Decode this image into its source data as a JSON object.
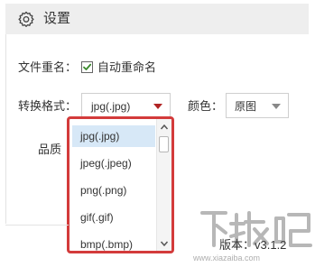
{
  "header": {
    "title": "设置",
    "icon": "gear-icon"
  },
  "rename": {
    "label": "文件重名：",
    "checkbox_label": "自动重命名",
    "checked": true
  },
  "format": {
    "label": "转换格式：",
    "selected": "jpg(.jpg)",
    "caret_color": "#b02323",
    "options": [
      "jpg(.jpg)",
      "jpeg(.jpeg)",
      "png(.png)",
      "gif(.gif)",
      "bmp(.bmp)"
    ],
    "highlight_color": "#d33b3b"
  },
  "color": {
    "label": "颜色：",
    "selected": "原图"
  },
  "quality": {
    "label": "品质"
  },
  "footer": {
    "version": "版本：v3.1.2"
  },
  "watermark": {
    "text": "下载吧",
    "url": "www.xiazaiba.com"
  }
}
